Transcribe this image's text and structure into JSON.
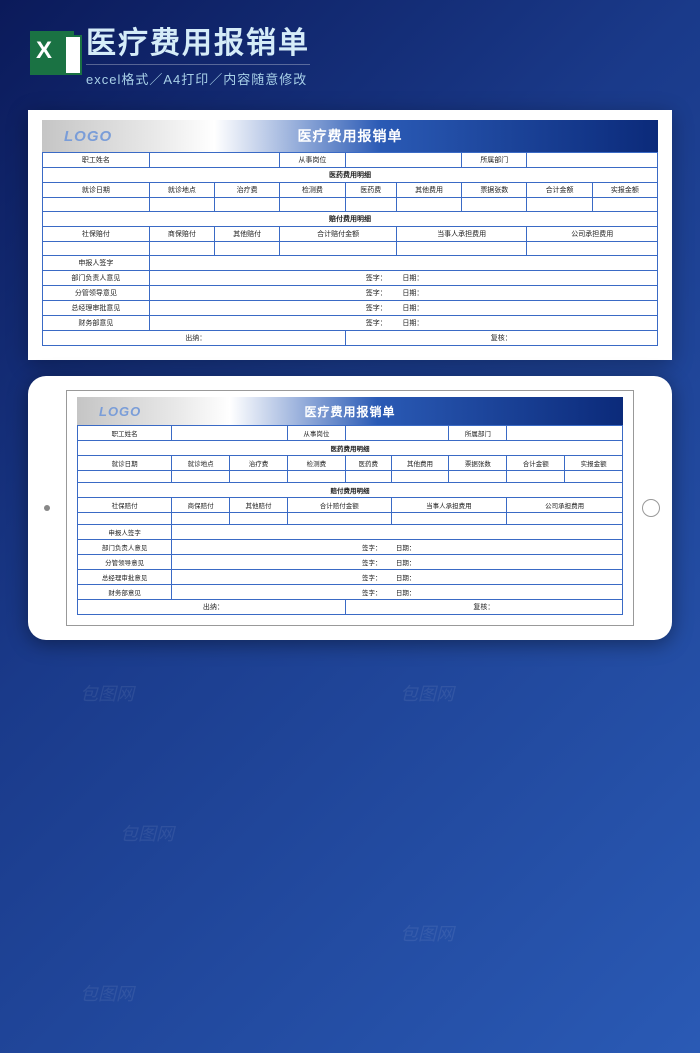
{
  "banner": {
    "title": "医疗费用报销单",
    "subtitle": "excel格式／A4打印／内容随意修改"
  },
  "form": {
    "logo": "LOGO",
    "title": "医疗费用报销单",
    "row1": {
      "employee_name": "职工姓名",
      "position": "从事岗位",
      "department": "所属部门"
    },
    "section1": "医药费用明细",
    "cols1": {
      "c1": "就诊日期",
      "c2": "就诊地点",
      "c3": "治疗费",
      "c4": "检测费",
      "c5": "医药费",
      "c6": "其他费用",
      "c7": "票据张数",
      "c8": "合计金额",
      "c9": "实报金额"
    },
    "section2": "赔付费用明细",
    "cols2": {
      "c1": "社保赔付",
      "c2": "商保赔付",
      "c3": "其他赔付",
      "c4": "合计赔付金额",
      "c5": "当事人承担费用",
      "c6": "公司承担费用"
    },
    "approvals": {
      "a1": "申报人签字",
      "a2": "部门负责人意见",
      "a3": "分管领导意见",
      "a4": "总经理审批意见",
      "a5": "财务部意见"
    },
    "sign_label": "签字：",
    "date_label": "日期：",
    "footer_cashier": "出纳：",
    "footer_reviewer": "复核："
  },
  "watermark": "包图网"
}
